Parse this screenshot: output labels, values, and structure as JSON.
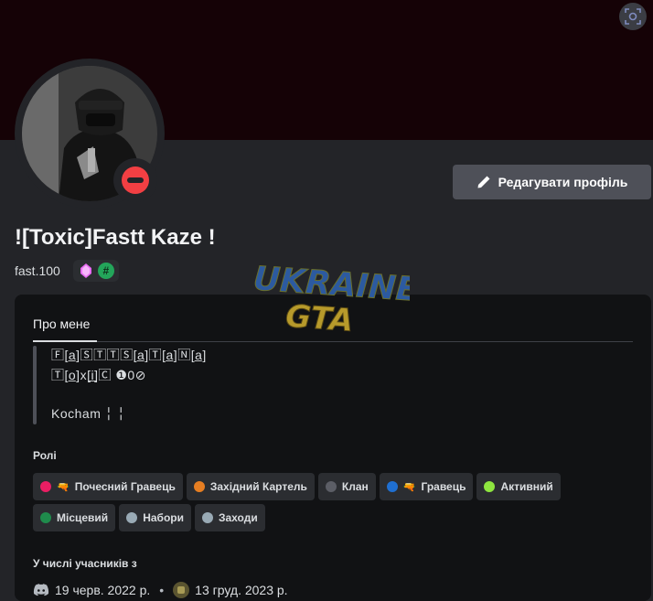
{
  "profile": {
    "display_name": "![Toxic]Fastt Kaze !",
    "username": "fast.100",
    "badge_hash_glyph": "#",
    "status": "do-not-disturb",
    "edit_button_label": "Редагувати профіль"
  },
  "about": {
    "tab_label": "Про мене",
    "lines": [
      "🄵[a̲]🅂🅃🅃🅂[a̲]🅃[a̲]🄽[a̲]",
      "🅃[o̲]x[i̲]🄲 ❶0⊘",
      "Kocham ╎ ╎"
    ]
  },
  "roles": {
    "title": "Ролі",
    "items": [
      {
        "label": "Почесний Гравець",
        "color": "#e91e63",
        "emoji": "🔫"
      },
      {
        "label": "Західний Картель",
        "color": "#e67e22",
        "emoji": ""
      },
      {
        "label": "Клан",
        "color": "#5c5e66",
        "emoji": ""
      },
      {
        "label": "Гравець",
        "color": "#1f6fd1",
        "emoji": "🔫"
      },
      {
        "label": "Активний",
        "color": "#8ee53f",
        "emoji": ""
      },
      {
        "label": "Місцевий",
        "color": "#1f8b4c",
        "emoji": ""
      },
      {
        "label": "Набори",
        "color": "#99aab5",
        "emoji": ""
      },
      {
        "label": "Заходи",
        "color": "#99aab5",
        "emoji": ""
      }
    ]
  },
  "membership": {
    "title": "У числі учасників з",
    "discord_date": "19 черв. 2022 р.",
    "server_date": "13 груд. 2023 р.",
    "separator": "•"
  },
  "watermark": {
    "line1": "UKRAINE",
    "line2": "GTA"
  },
  "icons": {
    "scan": "scan-icon",
    "edit": "pencil-icon",
    "badge1": "nitro-gem-icon",
    "badge2": "hashtag-icon",
    "discord": "discord-logo-icon",
    "server": "server-icon"
  },
  "colors": {
    "banner": "#150206",
    "background": "#232428",
    "card": "#111214",
    "button": "#4e5058",
    "status_dnd": "#f23f43"
  }
}
